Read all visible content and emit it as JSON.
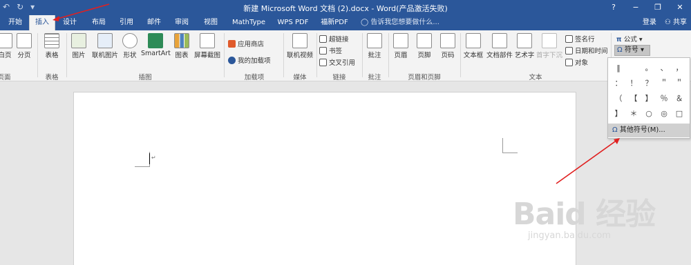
{
  "window": {
    "title": "新建 Microsoft Word 文档 (2).docx - Word(产品激活失败)",
    "controls": [
      "?",
      "−",
      "❐",
      "✕"
    ]
  },
  "qat": {
    "undo": "↶",
    "redo": "↻",
    "custom": "▾"
  },
  "tabs": [
    "开始",
    "插入",
    "设计",
    "布局",
    "引用",
    "邮件",
    "审阅",
    "视图",
    "MathType",
    "WPS PDF",
    "福新PDF"
  ],
  "tellme": "告诉我您想要做什么...",
  "account": {
    "login": "登录",
    "share": "共享"
  },
  "ribbon": {
    "pages": [
      "白页",
      "分页"
    ],
    "pages_group": "页面",
    "table": "表格",
    "table_group": "表格",
    "illustrations": [
      "图片",
      "联机图片",
      "形状",
      "SmartArt",
      "图表",
      "屏幕截图"
    ],
    "illustrations_group": "插图",
    "addins": [
      "应用商店",
      "我的加载项"
    ],
    "addins_group": "加载项",
    "media": "联机视频",
    "media_group": "媒体",
    "links": [
      "超链接",
      "书签",
      "交叉引用"
    ],
    "links_group": "链接",
    "comment": "批注",
    "comment_group": "批注",
    "header_footer": [
      "页眉",
      "页脚",
      "页码"
    ],
    "header_footer_group": "页眉和页脚",
    "text_items": [
      "文本框",
      "文档部件",
      "艺术字",
      "首字下沉"
    ],
    "text_small": [
      "签名行",
      "日期和时间",
      "对象"
    ],
    "text_group": "文本",
    "formula": "公式",
    "symbol": "符号"
  },
  "symbol_dropdown": {
    "symbols": [
      "‖",
      "　",
      "。",
      "、",
      "，",
      "：",
      "！",
      "？",
      "＂",
      "＂",
      "（",
      "【",
      "】",
      "％",
      "＆",
      "】",
      "＊",
      "○",
      "◎",
      "□"
    ],
    "more_symbols": "其他符号(M)..."
  },
  "document": {
    "paragraph_mark": "↵"
  },
  "watermark": {
    "main": "Baid 经验",
    "sub": "jingyan.baidu.com"
  },
  "colors": {
    "accent": "#2b579a",
    "annotation_arrow": "#e02020"
  }
}
